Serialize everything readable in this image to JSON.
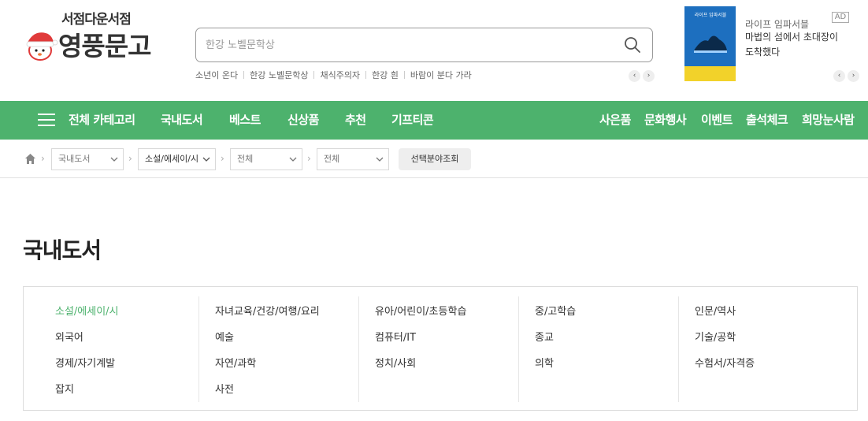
{
  "header": {
    "logo_tagline": "서점다운서점",
    "logo_name": "영풍문고",
    "search_placeholder": "한강 노벨문학상",
    "keywords": [
      "소년이 온다",
      "한강 노벨문학상",
      "채식주의자",
      "한강 흰",
      "바람이 분다 가라"
    ],
    "arrow_prev": "‹",
    "arrow_next": "›"
  },
  "ad": {
    "label": "AD",
    "book_title": "라이프 임파서블",
    "subtitle": "라이프 임파서블",
    "main_text": "마법의 섬에서 초대장이 도착했다"
  },
  "nav": {
    "all_category": "전체 카테고리",
    "left_items": [
      "국내도서",
      "베스트",
      "신상품",
      "추천",
      "기프티콘"
    ],
    "right_items": [
      "사은품",
      "문화행사",
      "이벤트",
      "출석체크",
      "희망눈사람"
    ]
  },
  "breadcrumb": {
    "selects": [
      "국내도서",
      "소설/에세이/시",
      "전체",
      "전체"
    ],
    "button": "선택분야조회"
  },
  "category": {
    "title": "국내도서",
    "columns": [
      [
        "소설/에세이/시",
        "외국어",
        "경제/자기계발",
        "잡지"
      ],
      [
        "자녀교육/건강/여행/요리",
        "예술",
        "자연/과학",
        "사전"
      ],
      [
        "유아/어린이/초등학습",
        "컴퓨터/IT",
        "정치/사회"
      ],
      [
        "중/고학습",
        "종교",
        "의학"
      ],
      [
        "인문/역사",
        "기술/공학",
        "수험서/자격증"
      ]
    ],
    "active_item": "소설/에세이/시"
  },
  "colors": {
    "brand_green": "#4db26d",
    "logo_red": "#e03a3a"
  }
}
